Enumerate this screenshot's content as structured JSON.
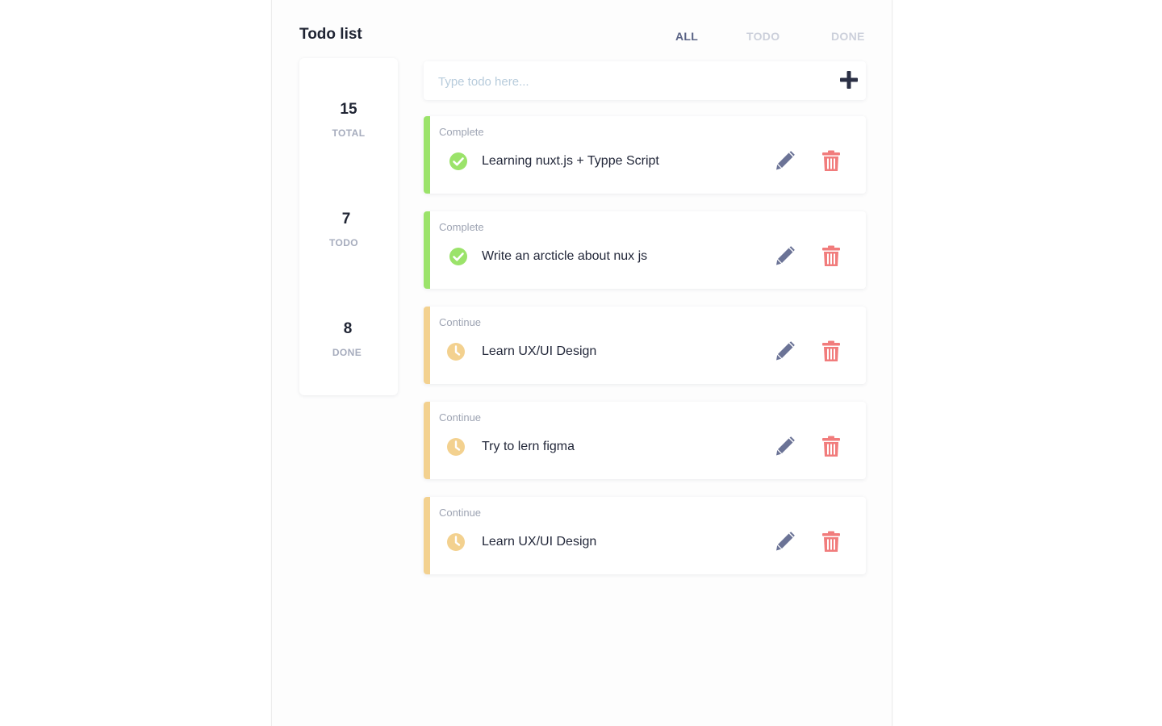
{
  "header": {
    "title": "Todo list"
  },
  "filters": [
    {
      "label": "ALL",
      "active": true
    },
    {
      "label": "TODO",
      "active": false
    },
    {
      "label": "DONE",
      "active": false
    }
  ],
  "stats": [
    {
      "value": "15",
      "label": "TOTAL"
    },
    {
      "value": "7",
      "label": "TODO"
    },
    {
      "value": "8",
      "label": "DONE"
    }
  ],
  "new_todo": {
    "placeholder": "Type todo here...",
    "value": ""
  },
  "todos": [
    {
      "status": "Complete",
      "text": "Learning nuxt.js + Typpe Script",
      "state": "complete"
    },
    {
      "status": "Complete",
      "text": "Write an arcticle about nux js",
      "state": "complete"
    },
    {
      "status": "Continue",
      "text": "Learn UX/UI Design",
      "state": "continue"
    },
    {
      "status": "Continue",
      "text": "Try to lern figma",
      "state": "continue"
    },
    {
      "status": "Continue",
      "text": "Learn UX/UI Design",
      "state": "continue"
    }
  ],
  "colors": {
    "complete": "#9be36a",
    "continue": "#f3d18f",
    "edit_icon": "#6b7396",
    "delete_icon": "#f17c7c",
    "add_icon": "#2b3045"
  },
  "icons": {
    "complete": "check-circle-icon",
    "continue": "clock-icon",
    "edit": "pencil-icon",
    "delete": "trash-icon",
    "add": "plus-icon"
  }
}
